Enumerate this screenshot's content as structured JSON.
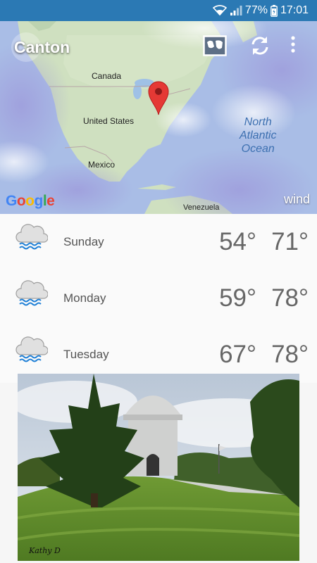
{
  "status_bar": {
    "battery_percent": "77%",
    "time": "17:01"
  },
  "header": {
    "city": "Canton"
  },
  "map": {
    "labels": {
      "canada": "Canada",
      "united_states": "United States",
      "mexico": "Mexico",
      "venezuela": "Venezuela",
      "ocean_line1": "North",
      "ocean_line2": "Atlantic",
      "ocean_line3": "Ocean"
    },
    "attribution": "Google",
    "layer": "wind"
  },
  "forecast": [
    {
      "day": "Sunday",
      "low": "54°",
      "high": "71°",
      "icon": "rain-cloud-icon"
    },
    {
      "day": "Monday",
      "low": "59°",
      "high": "78°",
      "icon": "rain-cloud-icon"
    },
    {
      "day": "Tuesday",
      "low": "67°",
      "high": "78°",
      "icon": "rain-cloud-icon"
    }
  ],
  "photo": {
    "signature": "Kathy D"
  },
  "colors": {
    "status_bar": "#2b79b4",
    "text_gray": "#666666",
    "pin_red": "#e53935"
  }
}
